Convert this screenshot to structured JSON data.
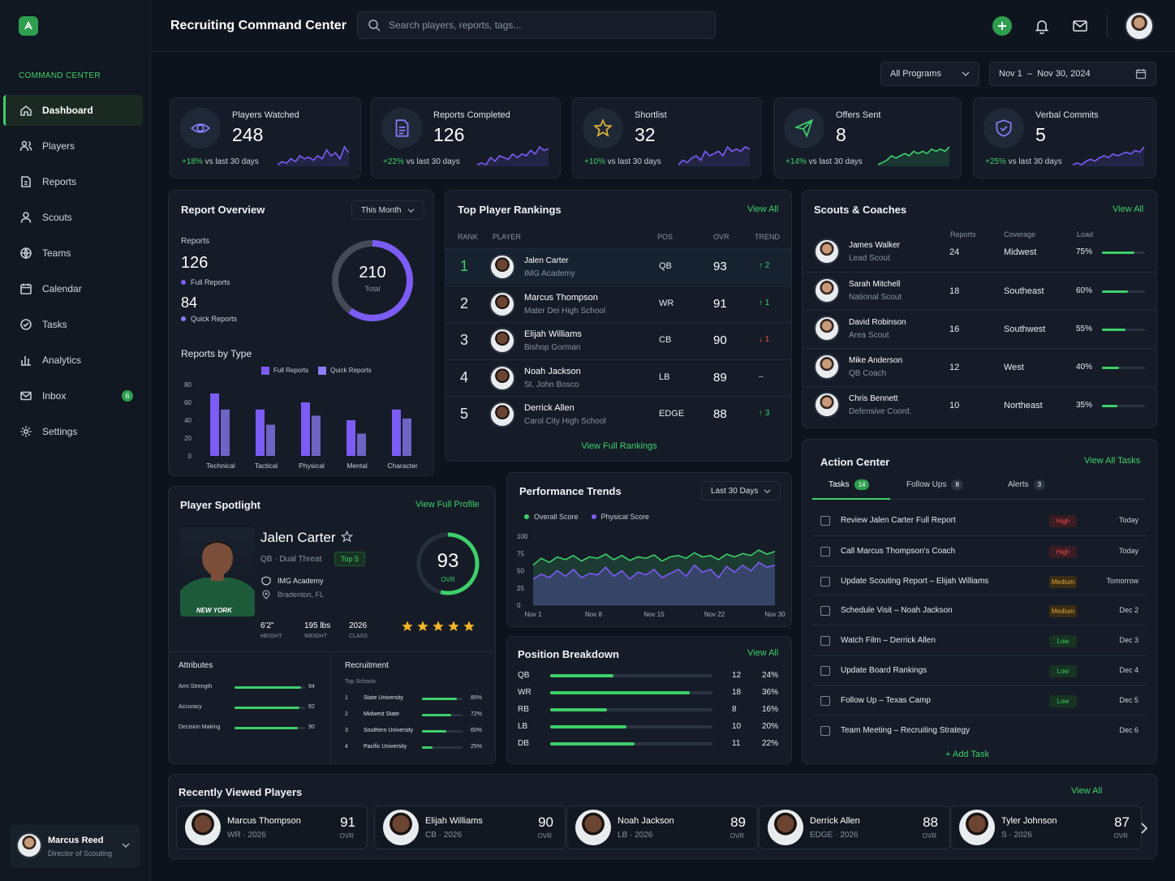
{
  "app": {
    "title": "Recruiting Command Center"
  },
  "search": {
    "placeholder": "Search players, reports, tags..."
  },
  "sidebar": {
    "section": "COMMAND CENTER",
    "items": [
      {
        "label": "Dashboard",
        "icon": "home-icon"
      },
      {
        "label": "Players",
        "icon": "players-icon"
      },
      {
        "label": "Reports",
        "icon": "reports-icon"
      },
      {
        "label": "Scouts",
        "icon": "scouts-icon"
      },
      {
        "label": "Teams",
        "icon": "teams-icon"
      },
      {
        "label": "Calendar",
        "icon": "calendar-icon"
      },
      {
        "label": "Tasks",
        "icon": "tasks-icon"
      },
      {
        "label": "Analytics",
        "icon": "analytics-icon"
      },
      {
        "label": "Inbox",
        "icon": "inbox-icon",
        "badge": "6"
      },
      {
        "label": "Settings",
        "icon": "settings-icon"
      }
    ],
    "user": {
      "name": "Marcus Reed",
      "role": "Director of Scouting"
    }
  },
  "filters": {
    "program": "All Programs",
    "date_from": "Nov  1",
    "date_sep": "–",
    "date_to": "Nov 30, 2024"
  },
  "stats": [
    {
      "label": "Players Watched",
      "value": "248",
      "change": "+18%",
      "suffix": "vs last 30 days",
      "spark_color": "#7b5cf5",
      "spark": [
        3,
        4,
        3.5,
        5,
        4,
        6,
        5,
        5.5,
        4.5,
        6,
        5,
        8,
        6,
        7,
        5,
        9,
        7
      ]
    },
    {
      "label": "Reports Completed",
      "value": "126",
      "change": "+22%",
      "suffix": "vs last 30 days",
      "spark_color": "#7b5cf5",
      "spark": [
        3,
        3.5,
        3,
        5,
        4,
        5.5,
        5,
        4.5,
        6,
        5,
        6,
        5.5,
        7,
        6,
        8,
        7,
        7.5
      ]
    },
    {
      "label": "Shortlist",
      "value": "32",
      "change": "+10%",
      "suffix": "vs last 30 days",
      "spark_color": "#7b5cf5",
      "spark": [
        3,
        4,
        3.5,
        4.5,
        5,
        4,
        6,
        5,
        5.5,
        6,
        5,
        7,
        6,
        6.5,
        6,
        7,
        6.5
      ]
    },
    {
      "label": "Offers Sent",
      "value": "8",
      "change": "+14%",
      "suffix": "vs last 30 days",
      "spark_color": "#3ecf6a",
      "spark": [
        3,
        3.5,
        4,
        5,
        4.5,
        5,
        5.5,
        5,
        6,
        5.5,
        6,
        5.5,
        6.5,
        6,
        6.5,
        6,
        7
      ]
    },
    {
      "label": "Verbal Commits",
      "value": "5",
      "change": "+25%",
      "suffix": "vs last 30 days",
      "spark_color": "#7b5cf5",
      "spark": [
        3,
        3.5,
        3,
        4,
        4.5,
        4,
        5,
        5.5,
        5,
        6,
        5.5,
        6,
        6.5,
        6,
        7,
        6.5,
        8
      ]
    }
  ],
  "report_overview": {
    "title": "Report Overview",
    "period": "This Month",
    "reports_label": "Reports",
    "reports_total": "126",
    "full_label": "Full Reports",
    "full_value": "84",
    "quick_label": "Quick Reports",
    "donut_total": "210",
    "donut_label": "Total",
    "donut_full_fraction": 0.6,
    "by_type_title": "Reports by Type",
    "legend_full": "Full Reports",
    "legend_quick": "Quick Reports"
  },
  "chart_data": [
    {
      "type": "bar",
      "categories": [
        "Technical",
        "Tactical",
        "Physical",
        "Mental",
        "Character"
      ],
      "series": [
        {
          "name": "Full Reports",
          "values": [
            70,
            52,
            60,
            40,
            52
          ]
        },
        {
          "name": "Quick Reports",
          "values": [
            52,
            35,
            45,
            25,
            42
          ]
        }
      ],
      "ylim": [
        0,
        80
      ],
      "yticks": [
        "0",
        "20",
        "40",
        "60",
        "80"
      ]
    },
    {
      "type": "line",
      "title": "Performance Trends",
      "x": [
        "Nov 1",
        "Nov 8",
        "Nov 15",
        "Nov 22",
        "Nov 30"
      ],
      "series": [
        {
          "name": "Overall Score",
          "color": "#3ecf6a",
          "values": [
            58,
            68,
            62,
            70,
            66,
            72,
            64,
            70,
            68,
            74,
            66,
            72,
            65,
            70,
            68,
            73,
            64,
            70,
            72,
            68,
            76,
            70,
            72,
            66,
            74,
            70,
            75,
            72,
            80,
            74,
            78
          ]
        },
        {
          "name": "Physical Score",
          "color": "#7b5cf5",
          "values": [
            38,
            45,
            40,
            50,
            42,
            52,
            40,
            46,
            44,
            55,
            42,
            50,
            38,
            48,
            44,
            52,
            40,
            46,
            52,
            42,
            58,
            48,
            52,
            40,
            56,
            48,
            58,
            50,
            62,
            55,
            58
          ]
        }
      ],
      "ylim": [
        0,
        100
      ],
      "yticks": [
        "0",
        "25",
        "50",
        "75",
        "100"
      ]
    }
  ],
  "rankings": {
    "title": "Top Player Rankings",
    "view_all": "View All",
    "headers": {
      "rank": "RANK",
      "player": "PLAYER",
      "pos": "POS",
      "ovr": "OVR",
      "trend": "TREND"
    },
    "footer": "View Full Rankings",
    "rows": [
      {
        "rank": "1",
        "name": "Jalen Carter",
        "school": "IMG Academy",
        "pos": "QB",
        "ovr": "93",
        "trend": "↑ 2",
        "dir": "up"
      },
      {
        "rank": "2",
        "name": "Marcus Thompson",
        "school": "Mater Dei High School",
        "pos": "WR",
        "ovr": "91",
        "trend": "↑ 1",
        "dir": "up"
      },
      {
        "rank": "3",
        "name": "Elijah Williams",
        "school": "Bishop Gorman",
        "pos": "CB",
        "ovr": "90",
        "trend": "↓ 1",
        "dir": "down"
      },
      {
        "rank": "4",
        "name": "Noah Jackson",
        "school": "St. John Bosco",
        "pos": "LB",
        "ovr": "89",
        "trend": "–",
        "dir": "flat"
      },
      {
        "rank": "5",
        "name": "Derrick Allen",
        "school": "Carol City High School",
        "pos": "EDGE",
        "ovr": "88",
        "trend": "↑ 3",
        "dir": "up"
      }
    ]
  },
  "scouts": {
    "title": "Scouts & Coaches",
    "view_all": "View All",
    "headers": {
      "reports": "Reports",
      "coverage": "Coverage",
      "load": "Load"
    },
    "rows": [
      {
        "name": "James Walker",
        "role": "Lead Scout",
        "reports": "24",
        "coverage": "Midwest",
        "load": "75%",
        "load_frac": 0.75
      },
      {
        "name": "Sarah Mitchell",
        "role": "National Scout",
        "reports": "18",
        "coverage": "Southeast",
        "load": "60%",
        "load_frac": 0.6
      },
      {
        "name": "David Robinson",
        "role": "Area Scout",
        "reports": "16",
        "coverage": "Southwest",
        "load": "55%",
        "load_frac": 0.55
      },
      {
        "name": "Mike Anderson",
        "role": "QB Coach",
        "reports": "12",
        "coverage": "West",
        "load": "40%",
        "load_frac": 0.4
      },
      {
        "name": "Chris Bennett",
        "role": "Defensive Coord.",
        "reports": "10",
        "coverage": "Northeast",
        "load": "35%",
        "load_frac": 0.35
      }
    ]
  },
  "spotlight": {
    "title": "Player Spotlight",
    "view": "View Full Profile",
    "name": "Jalen Carter",
    "position": "QB · Dual Threat",
    "tag": "Top 5",
    "school": "IMG Academy",
    "location": "Bradenton, FL",
    "height": "6'2\"",
    "height_label": "HEIGHT",
    "weight": "195 lbs",
    "weight_label": "WEIGHT",
    "class": "2026",
    "class_label": "CLASS",
    "ovr": "93",
    "ovr_label": "OVR",
    "rating": 5,
    "jersey": "NEW YORK",
    "attributes_title": "Attributes",
    "attributes": [
      {
        "label": "Arm Strength",
        "value": "94",
        "frac": 0.94
      },
      {
        "label": "Accuracy",
        "value": "92",
        "frac": 0.92
      },
      {
        "label": "Decision Making",
        "value": "90",
        "frac": 0.9
      }
    ],
    "recruitment_title": "Recruitment",
    "top_schools_label": "Top Schools",
    "schools": [
      {
        "rank": "1",
        "name": "State University",
        "pct": "85%",
        "frac": 0.85
      },
      {
        "rank": "2",
        "name": "Midwest State",
        "pct": "72%",
        "frac": 0.72
      },
      {
        "rank": "3",
        "name": "Southern University",
        "pct": "60%",
        "frac": 0.6
      },
      {
        "rank": "4",
        "name": "Pacific University",
        "pct": "25%",
        "frac": 0.25
      }
    ]
  },
  "performance": {
    "title": "Performance Trends",
    "period": "Last 30 Days",
    "legend_overall": "Overall Score",
    "legend_physical": "Physical Score"
  },
  "positions": {
    "title": "Position Breakdown",
    "view_all": "View All",
    "rows": [
      {
        "pos": "QB",
        "count": "12",
        "pct": "24%",
        "frac": 0.39
      },
      {
        "pos": "WR",
        "count": "18",
        "pct": "36%",
        "frac": 0.86
      },
      {
        "pos": "RB",
        "count": "8",
        "pct": "16%",
        "frac": 0.35
      },
      {
        "pos": "LB",
        "count": "10",
        "pct": "20%",
        "frac": 0.47
      },
      {
        "pos": "DB",
        "count": "11",
        "pct": "22%",
        "frac": 0.52
      }
    ]
  },
  "actions": {
    "title": "Action Center",
    "view_all": "View All Tasks",
    "tabs": [
      {
        "label": "Tasks",
        "count": "14"
      },
      {
        "label": "Follow Ups",
        "count": "8"
      },
      {
        "label": "Alerts",
        "count": "3"
      }
    ],
    "add": "Add Task",
    "tasks": [
      {
        "label": "Review Jalen Carter Full Report",
        "priority": "High",
        "level": "high",
        "due": "Today"
      },
      {
        "label": "Call Marcus Thompson's Coach",
        "priority": "High",
        "level": "high",
        "due": "Today"
      },
      {
        "label": "Update Scouting Report – Elijah Williams",
        "priority": "Medium",
        "level": "medium",
        "due": "Tomorrow"
      },
      {
        "label": "Schedule Visit – Noah Jackson",
        "priority": "Medium",
        "level": "medium",
        "due": "Dec 2"
      },
      {
        "label": "Watch Film – Derrick Allen",
        "priority": "Low",
        "level": "low",
        "due": "Dec 3"
      },
      {
        "label": "Update Board Rankings",
        "priority": "Low",
        "level": "low",
        "due": "Dec 4"
      },
      {
        "label": "Follow Up – Texas Camp",
        "priority": "Low",
        "level": "low",
        "due": "Dec 5"
      },
      {
        "label": "Team Meeting – Recruiting Strategy",
        "priority": "",
        "level": "",
        "due": "Dec 6"
      }
    ]
  },
  "recent": {
    "title": "Recently Viewed Players",
    "view_all": "View All",
    "ovr_label": "OVR",
    "players": [
      {
        "name": "Marcus Thompson",
        "meta": "WR · 2026",
        "ovr": "91"
      },
      {
        "name": "Elijah Williams",
        "meta": "CB · 2026",
        "ovr": "90"
      },
      {
        "name": "Noah Jackson",
        "meta": "LB · 2026",
        "ovr": "89"
      },
      {
        "name": "Derrick Allen",
        "meta": "EDGE · 2026",
        "ovr": "88"
      },
      {
        "name": "Tyler Johnson",
        "meta": "S · 2026",
        "ovr": "87"
      }
    ]
  }
}
